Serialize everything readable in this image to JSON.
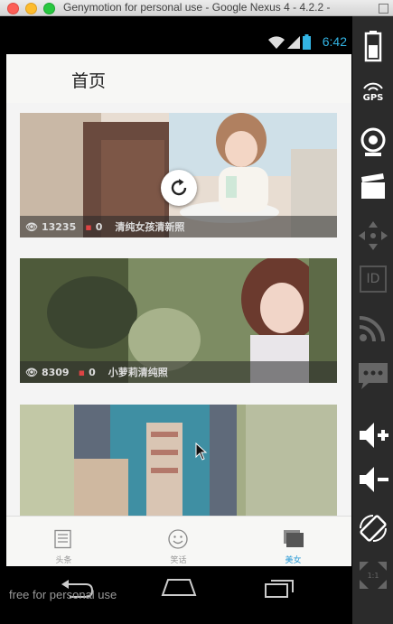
{
  "window": {
    "title": "Genymotion for personal use - Google Nexus 4 - 4.2.2 -"
  },
  "status_bar": {
    "time": "6:42"
  },
  "app": {
    "title": "首页"
  },
  "cards": [
    {
      "views": "13235",
      "comments": "0",
      "caption": "清纯女孩清新照"
    },
    {
      "views": "8309",
      "comments": "0",
      "caption": "小萝莉清纯照"
    },
    {
      "views": "",
      "comments": "",
      "caption": ""
    }
  ],
  "tabs": [
    {
      "label": "头条",
      "icon": "newspaper-icon",
      "active": false
    },
    {
      "label": "笑话",
      "icon": "smiley-icon",
      "active": false
    },
    {
      "label": "美女",
      "icon": "gallery-icon",
      "active": true
    }
  ],
  "watermark": "free for personal use",
  "sidebar": {
    "gps_label": "GPS",
    "id_label": "ID",
    "gps_icon": "gps-icon",
    "camera_icon": "webcam-icon"
  },
  "colors": {
    "accent": "#33b5e5",
    "active_tab": "#2b9bd6"
  }
}
